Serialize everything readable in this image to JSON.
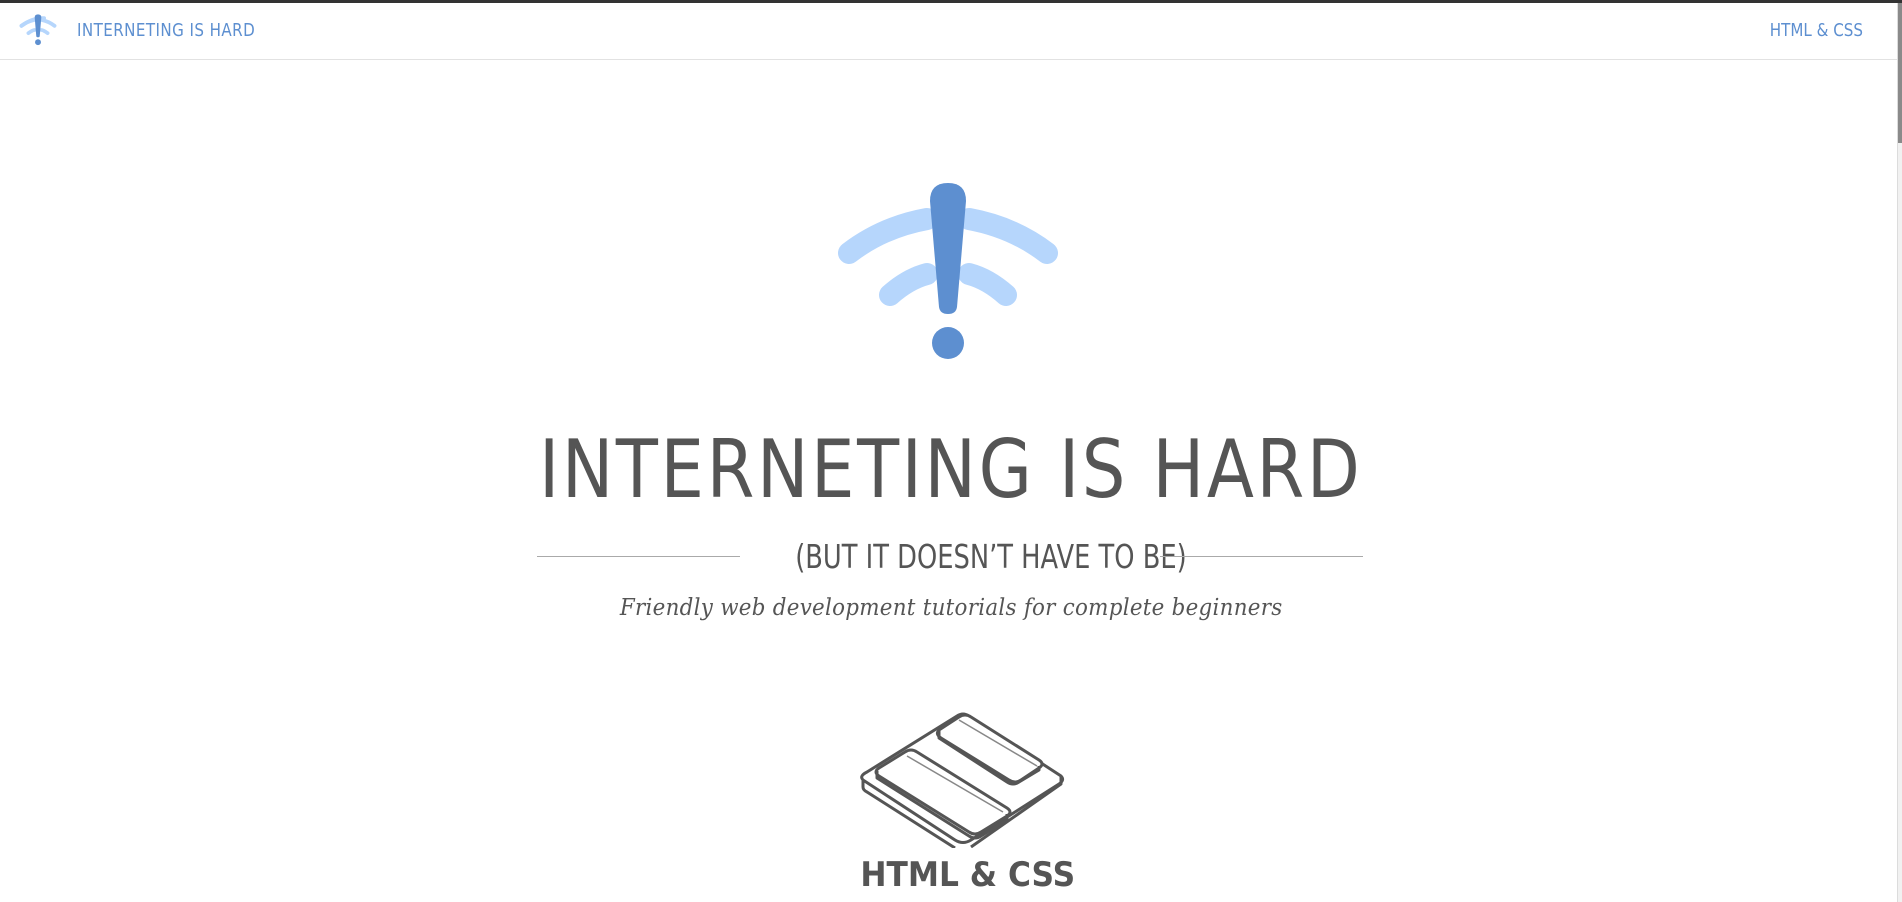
{
  "header": {
    "site_title": "INTERNETING IS HARD",
    "nav_link": "HTML & CSS"
  },
  "hero": {
    "title": "INTERNETING IS HARD",
    "subtitle": "(BUT IT DOESN’T HAVE TO BE)",
    "tagline": "Friendly web development tutorials for complete beginners"
  },
  "courses": [
    {
      "title": "HTML & CSS"
    }
  ],
  "colors": {
    "brand_blue": "#5d8fd0",
    "light_blue": "#b6d6fc",
    "text_gray": "#555555"
  },
  "icons": {
    "logo": "exclamation-wifi-icon",
    "course": "stacked-panels-icon"
  }
}
